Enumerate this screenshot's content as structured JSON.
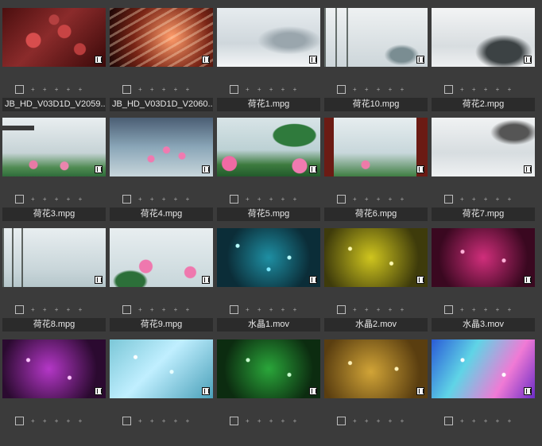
{
  "clips": [
    {
      "name": "JB_HD_V03D1D_V2059...",
      "stars": "+ + + + +",
      "art": "cells"
    },
    {
      "name": "JB_HD_V03D1D_V2060...",
      "stars": "+ + + + +",
      "art": "ribs"
    },
    {
      "name": "荷花1.mpg",
      "stars": "+ + + + +",
      "art": "mist"
    },
    {
      "name": "荷花10.mpg",
      "stars": "+ + + + +",
      "art": "bamboo"
    },
    {
      "name": "荷花2.mpg",
      "stars": "+ + + + +",
      "art": "mountain"
    },
    {
      "name": "荷花3.mpg",
      "stars": "+ + + + +",
      "art": "pavilion"
    },
    {
      "name": "荷花4.mpg",
      "stars": "+ + + + +",
      "art": "pond"
    },
    {
      "name": "荷花5.mpg",
      "stars": "+ + + + +",
      "art": "lotus"
    },
    {
      "name": "荷花6.mpg",
      "stars": "+ + + + +",
      "art": "window"
    },
    {
      "name": "荷花7.mpg",
      "stars": "+ + + + +",
      "art": "fog"
    },
    {
      "name": "荷花8.mpg",
      "stars": "+ + + + +",
      "art": "bamboo2"
    },
    {
      "name": "荷花9.mpg",
      "stars": "+ + + + +",
      "art": "lotus2"
    },
    {
      "name": "水晶1.mov",
      "stars": "+ + + + +",
      "art": "cyan"
    },
    {
      "name": "水晶2.mov",
      "stars": "+ + + + +",
      "art": "yellow"
    },
    {
      "name": "水晶3.mov",
      "stars": "+ + + + +",
      "art": "pink"
    },
    {
      "name": "",
      "stars": "+ + + + +",
      "art": "purple"
    },
    {
      "name": "",
      "stars": "+ + + + +",
      "art": "teal"
    },
    {
      "name": "",
      "stars": "+ + + + +",
      "art": "green"
    },
    {
      "name": "",
      "stars": "+ + + + +",
      "art": "gold"
    },
    {
      "name": "",
      "stars": "+ + + + +",
      "art": "rainbow"
    }
  ]
}
